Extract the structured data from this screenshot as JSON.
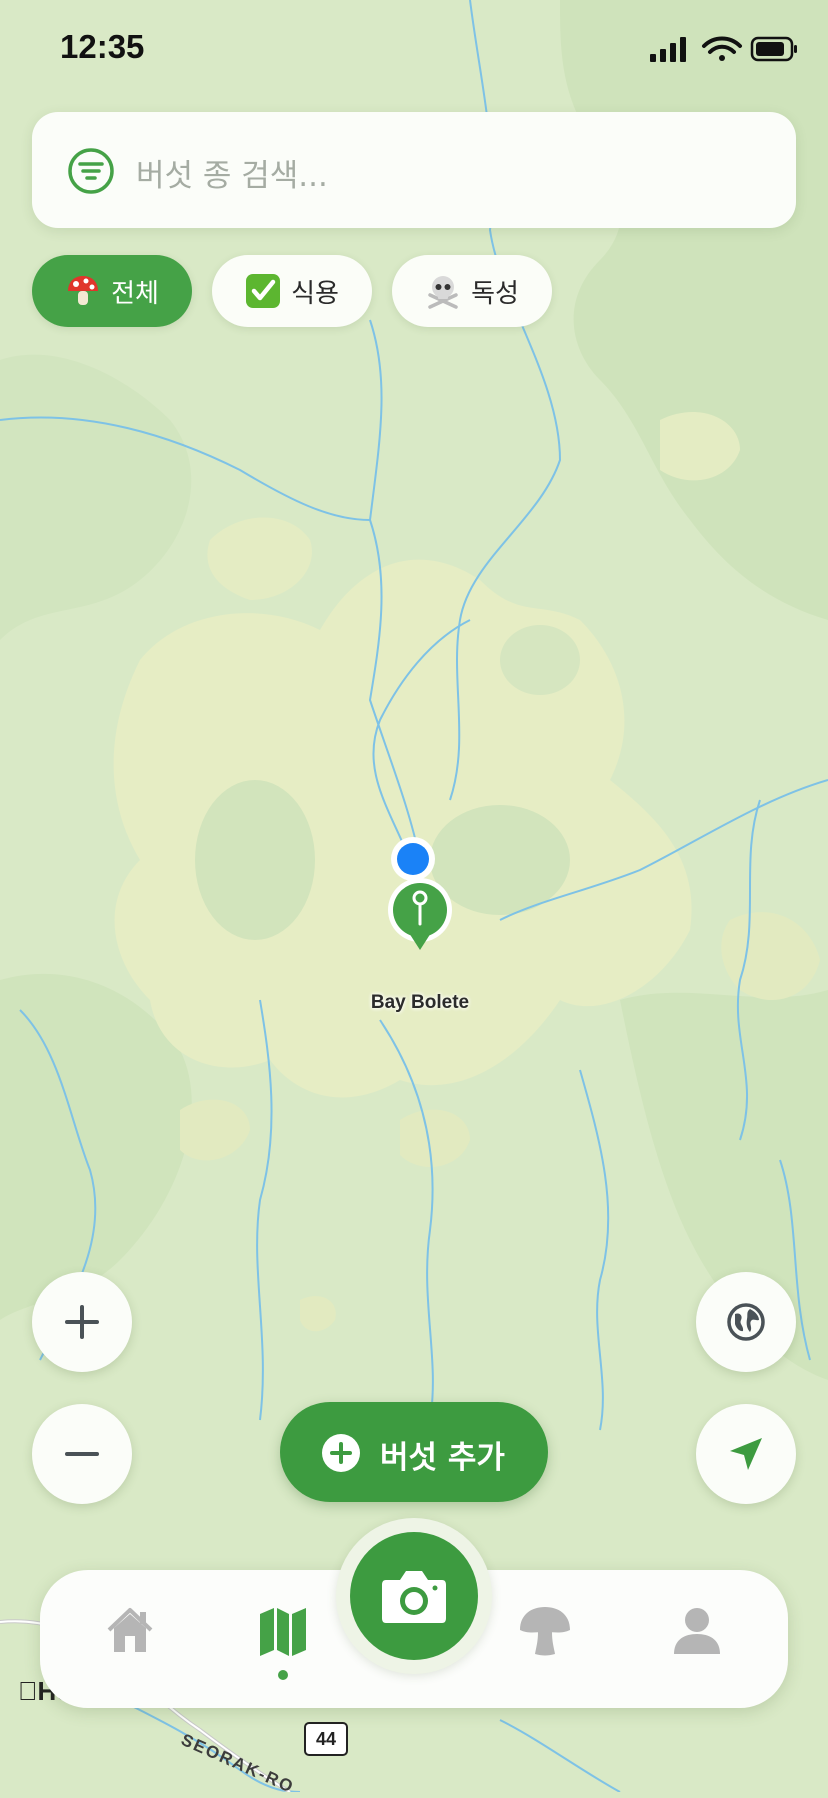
{
  "status_bar": {
    "time": "12:35",
    "icons": [
      "signal-icon",
      "wifi-icon",
      "battery-icon"
    ]
  },
  "search": {
    "placeholder": "버섯 종 검색...",
    "value": "",
    "icon": "filter-icon"
  },
  "filters": [
    {
      "emoji": "mushroom",
      "label": "전체",
      "selected": true
    },
    {
      "emoji": "check-mark",
      "label": "식용",
      "selected": false
    },
    {
      "emoji": "skull-crossbones",
      "label": "독성",
      "selected": false
    }
  ],
  "map": {
    "pin_label": "Bay Bolete",
    "legal_text": "Ho",
    "road_number": "44",
    "road_name": "SEORAK-RO"
  },
  "controls": {
    "zoom_in": "plus-icon",
    "zoom_out": "minus-icon",
    "map_style": "globe-icon",
    "locate": "location-arrow-icon"
  },
  "add_button": {
    "label": "버섯 추가"
  },
  "tab_bar": {
    "tabs": [
      "home-icon",
      "map-icon",
      "camera-icon",
      "mushroom-icon",
      "profile-icon"
    ],
    "active": "map-icon"
  },
  "colors": {
    "accent": "#3d9b40",
    "map_land": "#d9e9c6",
    "water": "#7ec2e6",
    "user_dot": "#1a82f7",
    "inactive_icon": "#b5b5b5"
  }
}
